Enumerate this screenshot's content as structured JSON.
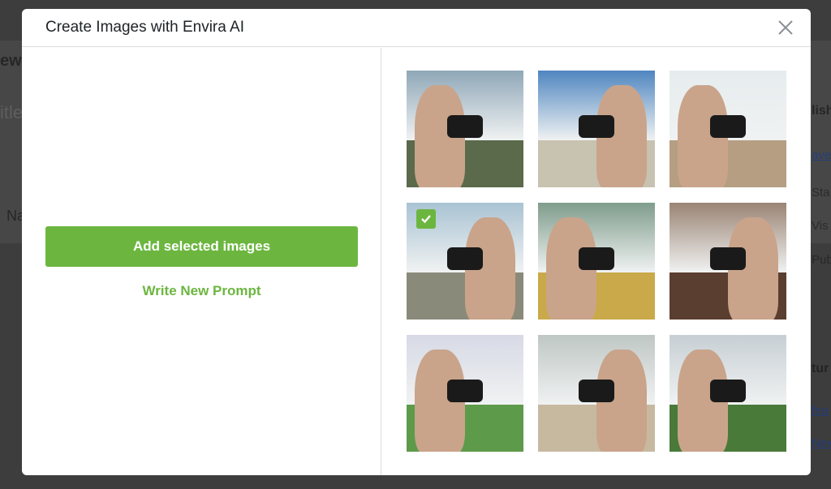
{
  "background": {
    "left_fragments": [
      "ew",
      "itle",
      "Na"
    ],
    "right_fragments": [
      "lish",
      "ave",
      "Sta",
      "Vis",
      "Pub",
      "tur",
      "fea",
      "Nex"
    ]
  },
  "modal": {
    "title": "Create Images with Envira AI",
    "close_icon": "close-icon",
    "add_button_label": "Add selected images",
    "write_prompt_label": "Write New Prompt",
    "accent_color": "#6cb640",
    "images": [
      {
        "selected": false,
        "sky": "#8fa7b8",
        "ground": "#5a6a4a"
      },
      {
        "selected": false,
        "sky": "#4f86c0",
        "ground": "#c8c2b0"
      },
      {
        "selected": false,
        "sky": "#e6ecee",
        "ground": "#b59e82"
      },
      {
        "selected": true,
        "sky": "#a9c3d3",
        "ground": "#8a8a7a"
      },
      {
        "selected": false,
        "sky": "#7f9c8c",
        "ground": "#c9a94a"
      },
      {
        "selected": false,
        "sky": "#9a8474",
        "ground": "#5a3e30"
      },
      {
        "selected": false,
        "sky": "#d7d9e6",
        "ground": "#5d9a4a"
      },
      {
        "selected": false,
        "sky": "#bfc7c4",
        "ground": "#c7b9a0"
      },
      {
        "selected": false,
        "sky": "#c7cfd4",
        "ground": "#4a7a3a"
      }
    ]
  }
}
